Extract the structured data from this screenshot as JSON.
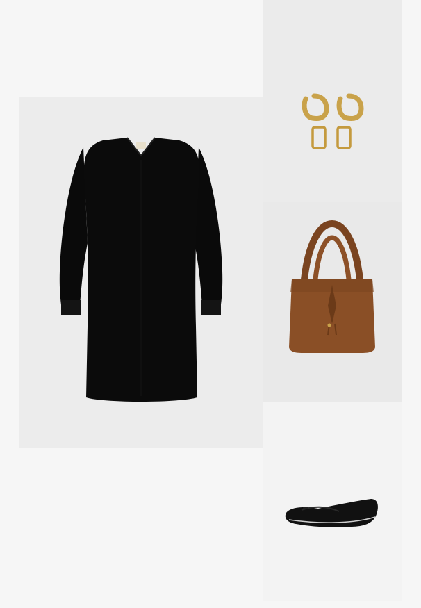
{
  "collage": {
    "items": [
      {
        "name": "dress",
        "description_color": "#0b0b0b"
      },
      {
        "name": "earrings",
        "description_color": "#c9a24a"
      },
      {
        "name": "tote-bag",
        "description_color": "#8a4f26"
      },
      {
        "name": "ballet-flat",
        "description_color": "#111111"
      }
    ],
    "background": "#f6f6f6"
  }
}
